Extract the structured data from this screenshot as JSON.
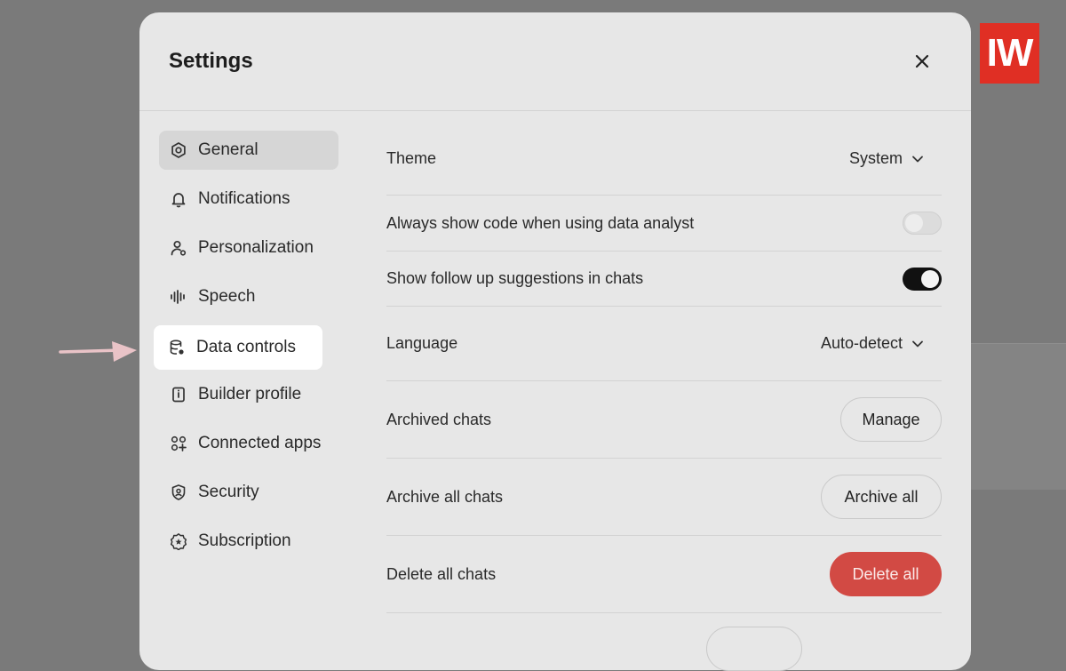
{
  "modal": {
    "title": "Settings"
  },
  "brand": {
    "logo_text": "IW",
    "accent": "#e02f24"
  },
  "sidebar": {
    "items": [
      {
        "label": "General",
        "icon": "gear-icon",
        "active": true
      },
      {
        "label": "Notifications",
        "icon": "bell-icon"
      },
      {
        "label": "Personalization",
        "icon": "user-icon"
      },
      {
        "label": "Speech",
        "icon": "waveform-icon"
      },
      {
        "label": "Data controls",
        "icon": "database-icon",
        "highlighted": true
      },
      {
        "label": "Builder profile",
        "icon": "id-card-icon"
      },
      {
        "label": "Connected apps",
        "icon": "apps-icon"
      },
      {
        "label": "Security",
        "icon": "shield-icon"
      },
      {
        "label": "Subscription",
        "icon": "badge-icon"
      }
    ]
  },
  "settings": {
    "theme": {
      "label": "Theme",
      "value": "System"
    },
    "show_code": {
      "label": "Always show code when using data analyst",
      "enabled": false
    },
    "follow_up": {
      "label": "Show follow up suggestions in chats",
      "enabled": true
    },
    "language": {
      "label": "Language",
      "value": "Auto-detect"
    },
    "archived_chats": {
      "label": "Archived chats",
      "button": "Manage"
    },
    "archive_all": {
      "label": "Archive all chats",
      "button": "Archive all"
    },
    "delete_all": {
      "label": "Delete all chats",
      "button": "Delete all",
      "color": "#d24a44"
    }
  }
}
